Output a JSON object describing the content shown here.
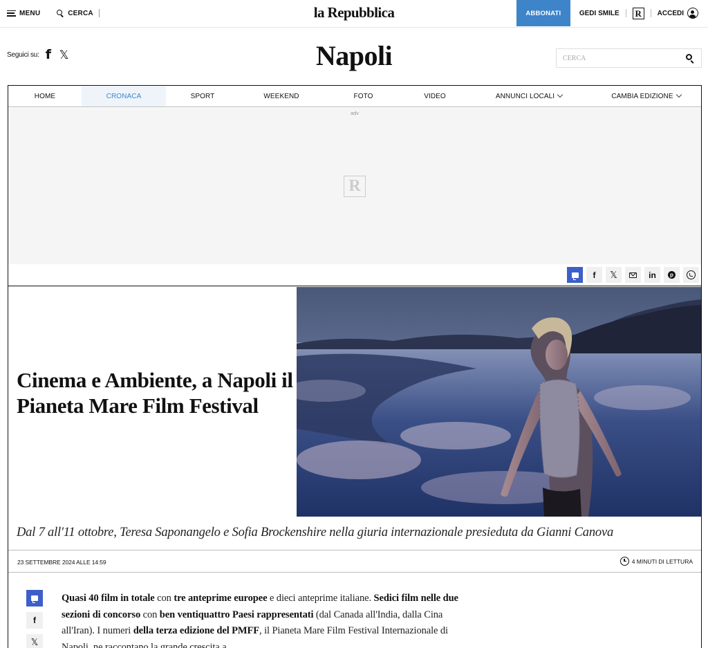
{
  "topbar": {
    "menu_label": "MENU",
    "search_label": "CERCA",
    "logo": "la Repubblica",
    "subscribe_label": "ABBONATI",
    "gedi_label": "GEDI SMILE",
    "r_badge": "R",
    "login_label": "ACCEDI"
  },
  "edition": {
    "follow_label": "Seguici su:",
    "facebook_glyph": "f",
    "x_glyph": "𝕏",
    "title": "Napoli",
    "search_placeholder": "CERCA"
  },
  "nav": {
    "items": [
      {
        "label": "HOME",
        "active": false
      },
      {
        "label": "CRONACA",
        "active": true
      },
      {
        "label": "SPORT",
        "active": false
      },
      {
        "label": "WEEKEND",
        "active": false
      },
      {
        "label": "FOTO",
        "active": false
      },
      {
        "label": "VIDEO",
        "active": false
      },
      {
        "label": "ANNUNCI LOCALI",
        "active": false,
        "dropdown": true
      },
      {
        "label": "CAMBIA EDIZIONE",
        "active": false,
        "dropdown": true
      }
    ]
  },
  "adv": {
    "label": "adv",
    "placeholder_logo": "R"
  },
  "share": {
    "icons": [
      "comment-icon",
      "facebook-icon",
      "x-icon",
      "email-icon",
      "linkedin-icon",
      "pinterest-icon",
      "whatsapp-icon"
    ],
    "facebook_glyph": "f",
    "x_glyph": "𝕏",
    "linkedin_glyph": "in",
    "pinterest_glyph": "p"
  },
  "article": {
    "headline": "Cinema e Ambiente, a Napoli il Pianeta Mare Film Festival",
    "subtitle": "Dal 7 all'11 ottobre, Teresa Saponangelo e Sofia Brockenshire nella giuria internazionale presieduta da Gianni Canova",
    "date": "23 SETTEMBRE 2024 ALLE 14:59",
    "reading_time": "4 MINUTI DI LETTURA",
    "body": [
      {
        "text": "Quasi 40 film in totale",
        "bold": true
      },
      {
        "text": " con ",
        "bold": false
      },
      {
        "text": "tre anteprime europee",
        "bold": true
      },
      {
        "text": " e dieci anteprime italiane. ",
        "bold": false
      },
      {
        "text": "Sedici film nelle due sezioni di concorso",
        "bold": true
      },
      {
        "text": " con ",
        "bold": false
      },
      {
        "text": "ben ventiquattro Paesi rappresentati",
        "bold": true
      },
      {
        "text": " (dal Canada all'India, dalla Cina all'Iran). I numeri ",
        "bold": false
      },
      {
        "text": "della terza edizione del PMFF",
        "bold": true
      },
      {
        "text": ", il Pianeta Mare Film Festival Internazionale di Napoli, ne raccontano la grande crescita a",
        "bold": false
      }
    ]
  },
  "colors": {
    "accent_blue": "#3d84c9",
    "comment_blue": "#3d5fc8",
    "nav_active_bg": "#eef4fa"
  }
}
